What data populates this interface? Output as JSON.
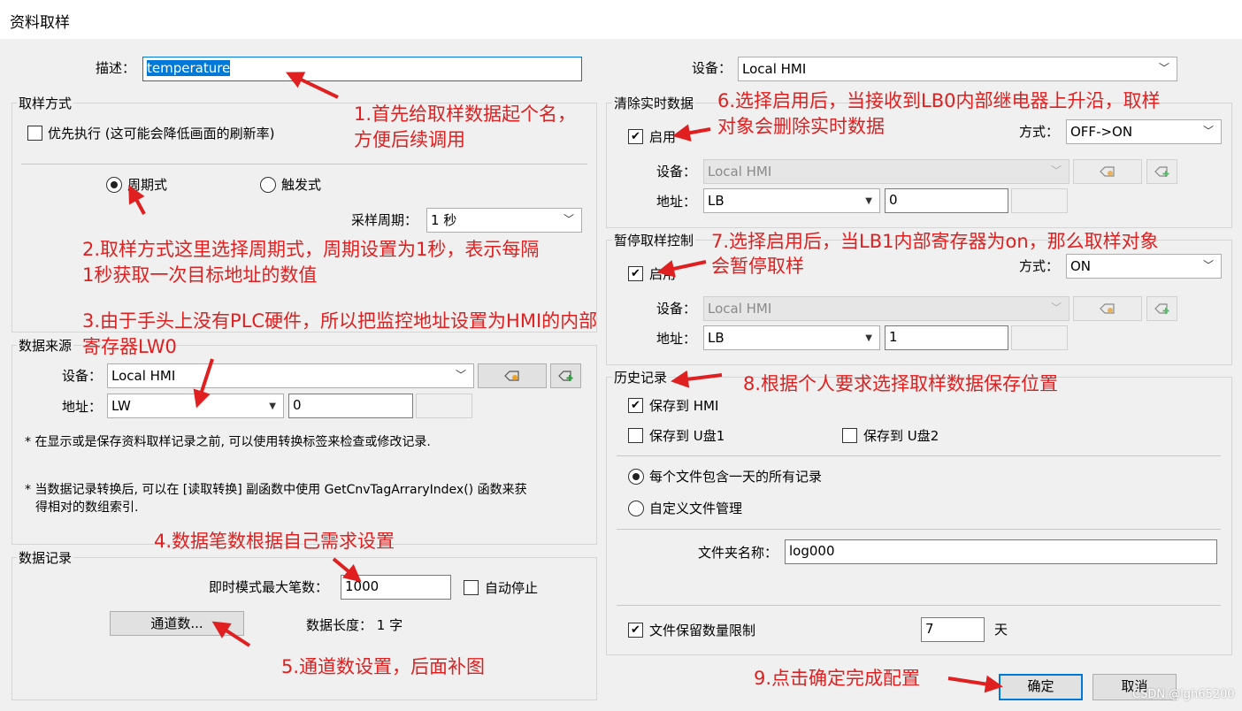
{
  "window": {
    "title": "资料取样"
  },
  "desc": {
    "label": "描述：",
    "value": "temperature"
  },
  "top_device": {
    "label": "设备：",
    "value": "Local HMI"
  },
  "sampling": {
    "group_label": "取样方式",
    "priority_label": "优先执行 (这可能会降低画面的刷新率)",
    "periodic_label": "周期式",
    "trigger_label": "触发式",
    "period_label": "采样周期：",
    "period_value": "1 秒"
  },
  "source": {
    "group_label": "数据来源",
    "device_label": "设备：",
    "device_value": "Local HMI",
    "address_label": "地址：",
    "address_type": "LW",
    "address_value": "0",
    "note1": "* 在显示或是保存资料取样记录之前, 可以使用转换标签来检查或修改记录.",
    "note2_line1": "* 当数据记录转换后, 可以在 [读取转换] 副函数中使用 GetCnvTagArraryIndex() 函数来获",
    "note2_line2": "得相对的数组索引."
  },
  "record": {
    "group_label": "数据记录",
    "max_label": "即时模式最大笔数：",
    "max_value": "1000",
    "auto_stop_label": "自动停止",
    "channels_button": "通道数...",
    "data_length": "数据长度： 1 字"
  },
  "clear": {
    "group_label": "清除实时数据",
    "enable_label": "启用",
    "mode_label": "方式：",
    "mode_value": "OFF->ON",
    "device_label": "设备：",
    "device_value": "Local HMI",
    "address_label": "地址：",
    "address_type": "LB",
    "address_value": "0"
  },
  "pause": {
    "group_label": "暂停取样控制",
    "enable_label": "启用",
    "mode_label": "方式：",
    "mode_value": "ON",
    "device_label": "设备：",
    "device_value": "Local HMI",
    "address_label": "地址：",
    "address_type": "LB",
    "address_value": "1"
  },
  "history": {
    "group_label": "历史记录",
    "save_hmi": "保存到 HMI",
    "save_u1": "保存到 U盘1",
    "save_u2": "保存到 U盘2",
    "one_day": "每个文件包含一天的所有记录",
    "custom": "自定义文件管理",
    "folder_label": "文件夹名称：",
    "folder_value": "log000",
    "limit_label": "文件保留数量限制",
    "limit_value": "7",
    "limit_unit": "天"
  },
  "buttons": {
    "ok": "确定",
    "cancel": "取消"
  },
  "annotations": {
    "a1_l1": "1.首先给取样数据起个名，",
    "a1_l2": "方便后续调用",
    "a2_l1": "2.取样方式这里选择周期式，周期设置为1秒，表示每隔",
    "a2_l2": "1秒获取一次目标地址的数值",
    "a3_l1": "3.由于手头上没有PLC硬件，所以把监控地址设置为HMI的内部",
    "a3_l2": "寄存器LW0",
    "a4": "4.数据笔数根据自己需求设置",
    "a5": "5.通道数设置，后面补图",
    "a6_l1": "6.选择启用后，当接收到LB0内部继电器上升沿，取样",
    "a6_l2": "对象会删除实时数据",
    "a7_l1": "7.选择启用后，当LB1内部寄存器为on，那么取样对象",
    "a7_l2": "会暂停取样",
    "a8": "8.根据个人要求选择取样数据保存位置",
    "a9": "9.点击确定完成配置"
  },
  "watermark": "CSDN @lgh65200",
  "colors": {
    "annotation": "#e02020",
    "selection": "#0078d7"
  },
  "icons": [
    "chevron-down-icon",
    "tag-icon",
    "tag-add-icon",
    "checkmark-icon",
    "arrow-icon"
  ]
}
